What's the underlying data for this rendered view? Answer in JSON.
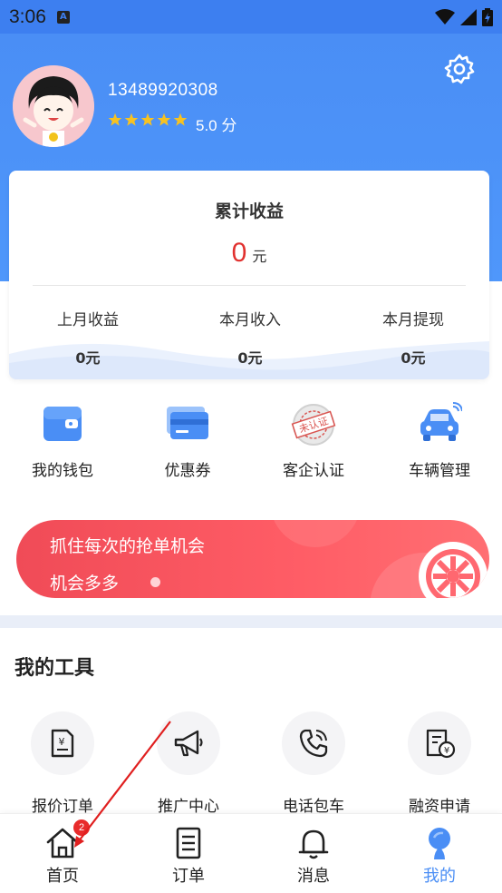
{
  "status_bar": {
    "time": "3:06",
    "notif_letter": "A"
  },
  "profile": {
    "phone": "13489920308",
    "rating_stars": 5,
    "score_label": "5.0 分"
  },
  "earnings": {
    "title": "累计收益",
    "total_value": "0",
    "total_unit": "元",
    "columns": [
      {
        "label": "上月收益",
        "value": "0元"
      },
      {
        "label": "本月收入",
        "value": "0元"
      },
      {
        "label": "本月提现",
        "value": "0元"
      }
    ]
  },
  "quick_actions": [
    {
      "label": "我的钱包",
      "icon": "wallet-icon"
    },
    {
      "label": "优惠券",
      "icon": "coupon-card-icon"
    },
    {
      "label": "客企认证",
      "icon": "certification-stamp-icon",
      "stamp_text": "未认证"
    },
    {
      "label": "车辆管理",
      "icon": "car-icon"
    }
  ],
  "banner": {
    "line1": "抓住每次的抢单机会",
    "line2": "机会多多"
  },
  "tools": {
    "title": "我的工具",
    "items": [
      {
        "label": "报价订单",
        "icon": "quote-document-icon"
      },
      {
        "label": "推广中心",
        "icon": "megaphone-icon"
      },
      {
        "label": "电话包车",
        "icon": "phone-call-icon"
      },
      {
        "label": "融资申请",
        "icon": "finance-bill-icon"
      }
    ]
  },
  "tabbar": {
    "items": [
      {
        "label": "首页",
        "icon": "home-icon",
        "badge": "2"
      },
      {
        "label": "订单",
        "icon": "order-document-icon"
      },
      {
        "label": "消息",
        "icon": "bell-icon"
      },
      {
        "label": "我的",
        "icon": "profile-icon",
        "active": true
      }
    ]
  },
  "colors": {
    "header_blue": "#4a8ef5",
    "accent_red": "#e1312f",
    "banner_red": "#f04b57",
    "active_tab": "#4a8ef5"
  }
}
